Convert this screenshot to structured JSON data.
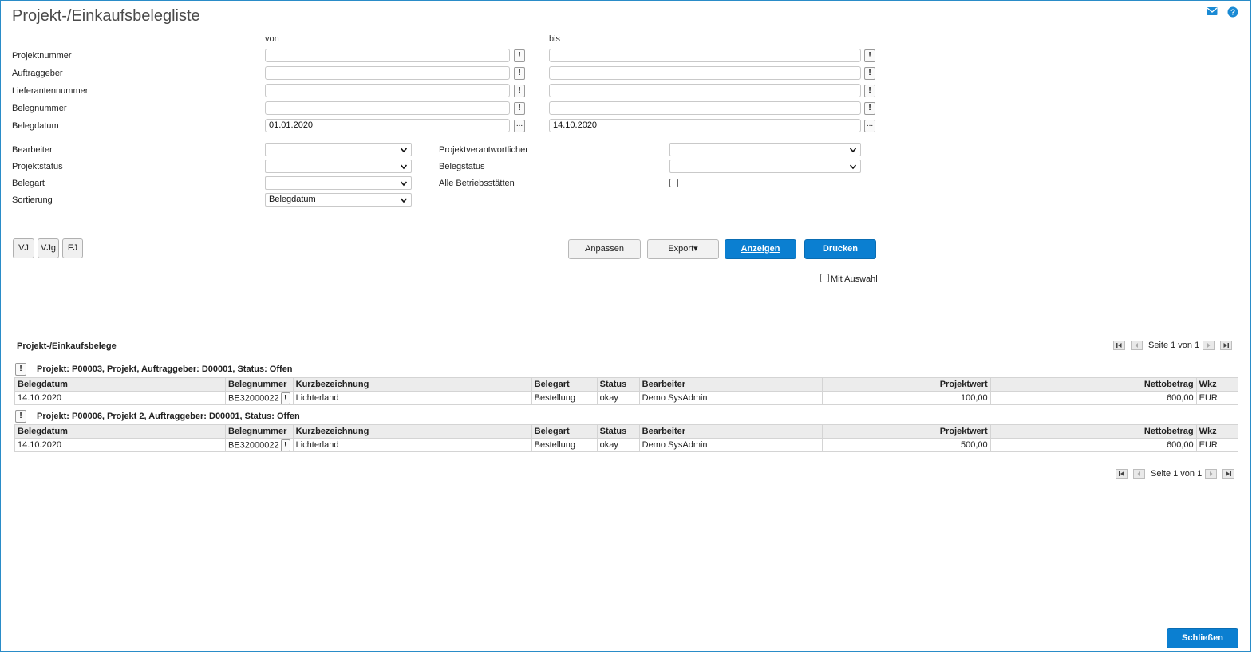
{
  "window": {
    "title": "Projekt-/Einkaufsbelegliste"
  },
  "header_icons": [
    "mail-icon",
    "help-icon"
  ],
  "filters": {
    "von_label": "von",
    "bis_label": "bis",
    "rows": [
      {
        "label": "Projektnummer",
        "from": "",
        "to": "",
        "btn": "!"
      },
      {
        "label": "Auftraggeber",
        "from": "",
        "to": "",
        "btn": "!"
      },
      {
        "label": "Lieferantennummer",
        "from": "",
        "to": "",
        "btn": "!"
      },
      {
        "label": "Belegnummer",
        "from": "",
        "to": "",
        "btn": "!"
      },
      {
        "label": "Belegdatum",
        "from": "01.01.2020",
        "to": "14.10.2020",
        "btn": "..."
      }
    ],
    "left_selects": [
      {
        "label": "Bearbeiter",
        "value": ""
      },
      {
        "label": "Projektstatus",
        "value": ""
      },
      {
        "label": "Belegart",
        "value": ""
      },
      {
        "label": "Sortierung",
        "value": "Belegdatum"
      }
    ],
    "right_selects": [
      {
        "label": "Projektverantwortlicher",
        "value": ""
      },
      {
        "label": "Belegstatus",
        "value": ""
      }
    ],
    "alle_betriebsstaetten_label": "Alle Betriebsstätten"
  },
  "period_buttons": [
    "VJ",
    "VJg",
    "FJ"
  ],
  "actions": {
    "anpassen": "Anpassen",
    "export": "Export▾",
    "anzeigen": "Anzeigen",
    "drucken": "Drucken",
    "mit_auswahl": "Mit Auswahl"
  },
  "results": {
    "title": "Projekt-/Einkaufsbelege",
    "pager_text": "Seite 1 von 1",
    "columns": [
      "Belegdatum",
      "Belegnummer",
      "Kurzbezeichnung",
      "Belegart",
      "Status",
      "Bearbeiter",
      "Projektwert",
      "Nettobetrag",
      "Wkz"
    ],
    "groups": [
      {
        "header": "Projekt: P00003, Projekt, Auftraggeber: D00001, Status: Offen",
        "rows": [
          {
            "belegdatum": "14.10.2020",
            "belegnummer": "BE32000022",
            "kurzbezeichnung": "Lichterland",
            "belegart": "Bestellung",
            "status": "okay",
            "bearbeiter": "Demo SysAdmin",
            "projektwert": "100,00",
            "nettobetrag": "600,00",
            "wkz": "EUR"
          }
        ]
      },
      {
        "header": "Projekt: P00006, Projekt 2, Auftraggeber: D00001, Status: Offen",
        "rows": [
          {
            "belegdatum": "14.10.2020",
            "belegnummer": "BE32000022",
            "kurzbezeichnung": "Lichterland",
            "belegart": "Bestellung",
            "status": "okay",
            "bearbeiter": "Demo SysAdmin",
            "projektwert": "500,00",
            "nettobetrag": "600,00",
            "wkz": "EUR"
          }
        ]
      }
    ]
  },
  "footer": {
    "close": "Schließen"
  },
  "colors": {
    "accent": "#0b7fd1",
    "border": "#2a8cc8"
  }
}
